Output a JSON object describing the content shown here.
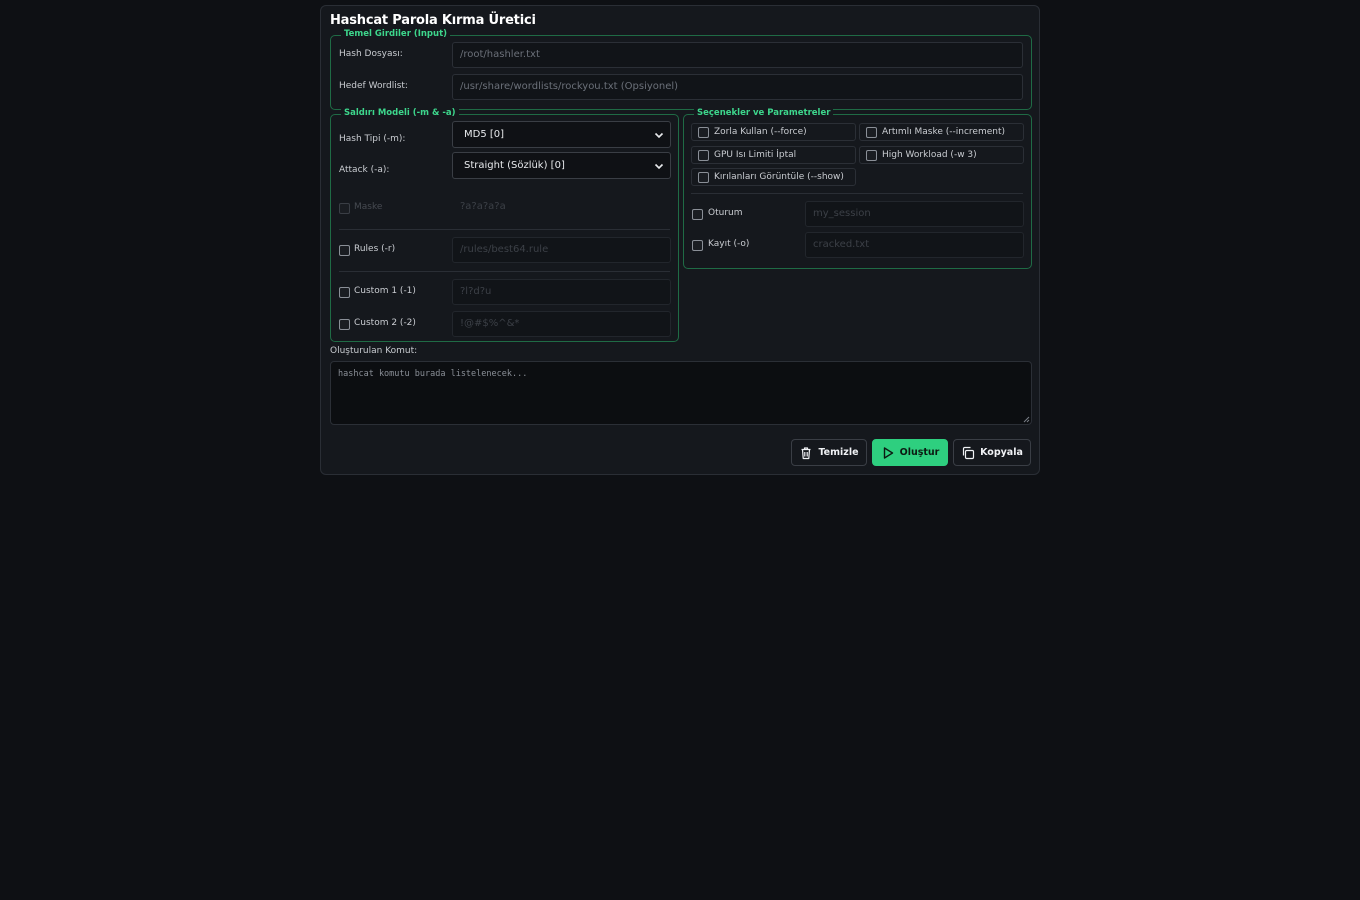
{
  "app": {
    "title": "Hashcat Parola Kırma Üretici"
  },
  "basic_inputs": {
    "legend": "Temel Girdiler (Input)",
    "hash_file_label": "Hash Dosyası:",
    "hash_file_placeholder": "/root/hashler.txt",
    "wordlist_label": "Hedef Wordlist:",
    "wordlist_placeholder": "/usr/share/wordlists/rockyou.txt (Opsiyonel)"
  },
  "attack_model": {
    "legend": "Saldırı Modeli (-m & -a)",
    "hash_type_label": "Hash Tipi (-m):",
    "hash_type_value": "MD5 [0]",
    "attack_label": "Attack (-a):",
    "attack_value": "Straight (Sözlük) [0]",
    "mask_label": "Maske",
    "mask_placeholder": "?a?a?a?a",
    "rules_label": "Rules (-r)",
    "rules_placeholder": "/rules/best64.rule",
    "custom1_label": "Custom 1 (-1)",
    "custom1_placeholder": "?l?d?u",
    "custom2_label": "Custom 2 (-2)",
    "custom2_placeholder": "!@#$%^&*"
  },
  "options": {
    "legend": "Seçenekler ve Parametreler",
    "force": "Zorla Kullan (--force)",
    "increment": "Artımlı Maske (--increment)",
    "gpu_temp": "GPU Isı Limiti İptal",
    "workload": "High Workload (-w 3)",
    "show": "Kırılanları Görüntüle (--show)",
    "session_label": "Oturum",
    "session_placeholder": "my_session",
    "output_label": "Kayıt (-o)",
    "output_placeholder": "cracked.txt"
  },
  "command": {
    "label": "Oluşturulan Komut:",
    "placeholder": "hashcat komutu burada listelenecek..."
  },
  "buttons": {
    "clear": "Temizle",
    "generate": "Oluştur",
    "copy": "Kopyala"
  },
  "colors": {
    "accent": "#3dd68c",
    "primary_button": "#2ecf7f",
    "background": "#0e1014",
    "panel": "#15181d"
  }
}
